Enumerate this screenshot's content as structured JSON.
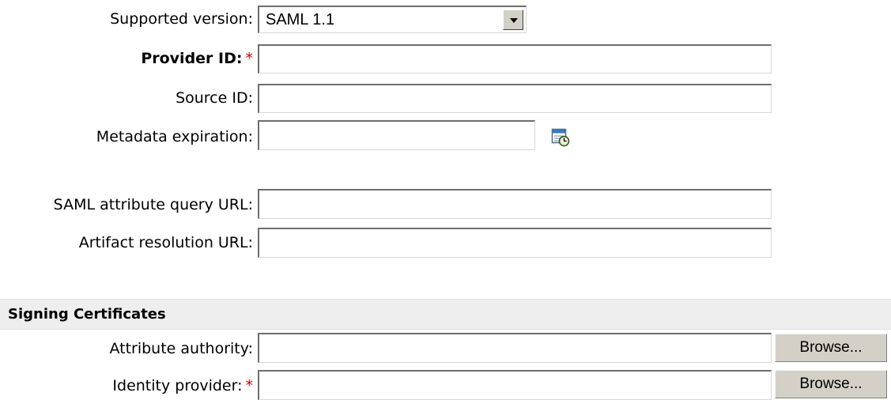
{
  "form": {
    "supported_version_label": "Supported version:",
    "supported_version_value": "SAML 1.1",
    "provider_id_label": "Provider ID:",
    "required_marker": "*",
    "source_id_label": "Source ID:",
    "metadata_expiration_label": "Metadata expiration:",
    "saml_attribute_query_url_label": "SAML attribute query URL:",
    "artifact_resolution_url_label": "Artifact resolution URL:",
    "provider_id_value": "",
    "source_id_value": "",
    "metadata_expiration_value": "",
    "saml_attribute_query_url_value": "",
    "artifact_resolution_url_value": ""
  },
  "signing": {
    "section_title": "Signing Certificates",
    "attribute_authority_label": "Attribute authority:",
    "identity_provider_label": "Identity provider:",
    "attribute_authority_value": "",
    "identity_provider_value": "",
    "browse_label": "Browse..."
  },
  "icons": {
    "calendar": "calendar-clock-icon",
    "dropdown": "chevron-down-icon"
  },
  "colors": {
    "required": "#cc0000",
    "section_bar": "#eeeeee",
    "button_face": "#d4d0c8"
  }
}
